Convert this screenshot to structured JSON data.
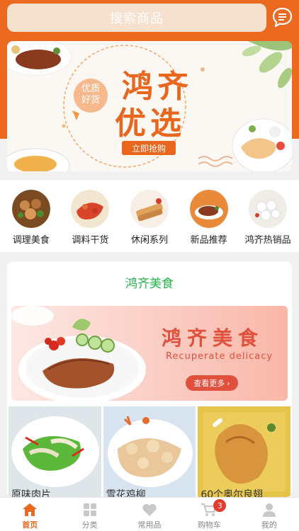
{
  "header": {
    "search_placeholder": "搜索商品",
    "message_icon": "chat-bubble-icon"
  },
  "banner": {
    "title_line1": "鸿齐",
    "title_line2": "优选",
    "badge_line1": "优质",
    "badge_line2": "好货",
    "cta": "立即抢购"
  },
  "categories": [
    {
      "label": "调理美食"
    },
    {
      "label": "调料干货"
    },
    {
      "label": "休闲系列"
    },
    {
      "label": "新品推荐"
    },
    {
      "label": "鸿齐热销品"
    }
  ],
  "section": {
    "title": "鸿齐美食",
    "promo_title": "鸿齐美食",
    "promo_subtitle": "Recuperate delicacy",
    "promo_button": "查看更多",
    "items": [
      {
        "name": "原味肉片"
      },
      {
        "name": "雪花鸡柳"
      },
      {
        "name": "60个奥尔良翅"
      }
    ]
  },
  "tabbar": {
    "tabs": [
      {
        "label": "首页",
        "icon": "home-icon"
      },
      {
        "label": "分类",
        "icon": "grid-icon"
      },
      {
        "label": "常用品",
        "icon": "heart-icon"
      },
      {
        "label": "购物车",
        "icon": "cart-icon"
      },
      {
        "label": "我的",
        "icon": "user-icon"
      }
    ],
    "cart_badge": "3"
  },
  "colors": {
    "accent": "#ec6a1f",
    "section_title": "#22b34a",
    "badge": "#e53b2f"
  }
}
